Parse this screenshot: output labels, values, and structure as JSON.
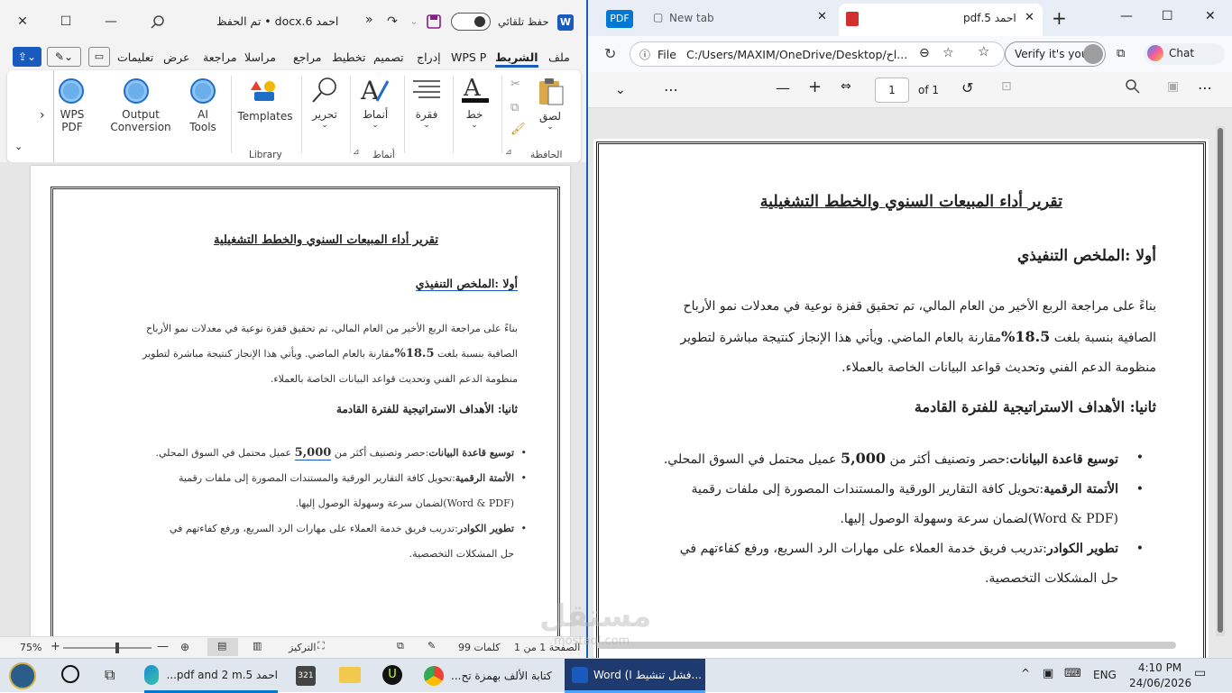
{
  "word": {
    "titlebar": {
      "autosave_label": "حفظ تلقائي",
      "doc_title": "احمد 6.docx • تم الحفظ",
      "expand": "»"
    },
    "tabs": [
      "ملف",
      "الشريط",
      "WPS P",
      "إدراج",
      "تصميم",
      "تخطيط",
      "مراجع",
      "مراسلا",
      "مراجعة",
      "عرض",
      "تعليمات"
    ],
    "ribbon": {
      "buttons": {
        "paste": "لصق",
        "font": "خط",
        "paragraph": "فقرة",
        "styles": "أنماط",
        "edit": "تحرير",
        "templates": "Templates",
        "ai_tools": "AI Tools",
        "output_conversion": "Output Conversion",
        "wps_pdf": "WPS PDF"
      },
      "groups": {
        "clipboard": "الحافظة",
        "styles": "أنماط",
        "library": "Library"
      },
      "more": "›"
    },
    "status": {
      "page": "الصفحة 1 من 1",
      "words": "99 كلمات",
      "focus": "التركيز",
      "zoom": "75%"
    }
  },
  "document": {
    "title": "تقرير أداء المبيعات السنوي والخطط التشغيلية",
    "h1": "أولا :الملخص التنفيذي",
    "p1_a": "بناءً على مراجعة الربع الأخير من العام المالي، تم تحقيق قفزة نوعية في معدلات نمو الأرباح",
    "p1_b_pre": "الصافية بنسبة بلغت ",
    "p1_b_bold": "18.5%",
    "p1_b_post": "مقارنة بالعام الماضي. ويأتي هذا الإنجاز كنتيجة مباشرة لتطوير",
    "p1_c": "منظومة الدعم الفني وتحديث قواعد البيانات الخاصة بالعملاء.",
    "h2": "ثانيا: الأهداف الاستراتيجية للفترة القادمة",
    "b1_bold": "توسيع قاعدة البيانات",
    "b1_text": ":حصر وتصنيف أكثر من ",
    "b1_num": "5,000",
    "b1_tail": " عميل محتمل في السوق المحلي.",
    "b2_bold": "الأتمتة الرقمية",
    "b2_text": ":تحويل كافة التقارير الورقية والمستندات المصورة إلى ملفات رقمية",
    "b2_cont": "(Word & PDF)لضمان سرعة وسهولة الوصول إليها.",
    "b3_bold": "تطوير الكوادر",
    "b3_text": ":تدريب فريق خدمة العملاء على مهارات الرد السريع، ورفع كفاءتهم في",
    "b3_cont": "حل المشكلات التخصصية."
  },
  "edge": {
    "tabs": [
      {
        "label": "PDF"
      },
      {
        "label": "New tab"
      },
      {
        "label": "احمد 5.pdf"
      }
    ],
    "address": {
      "scheme": "File",
      "url": "C:/Users/MAXIM/OneDrive/Desktop/اح...",
      "profile": "Verify it's you",
      "chat": "Chat"
    },
    "pdf": {
      "page_current": "1",
      "page_total": "of 1"
    }
  },
  "taskbar": {
    "items": [
      {
        "label": "احمد 5.pdf and 2 m..."
      },
      {
        "label": "كتابة الألف بهمزة تح..."
      },
      {
        "label": "Word (فشل تنشيط ا..."
      }
    ],
    "lang": "ENG",
    "time": "4:10 PM",
    "date": "24/06/2026"
  },
  "watermark": {
    "text1": "مستقل",
    "text2": "mostaql.com"
  },
  "colors": {
    "word_blue": "#185abd",
    "edge_blue": "#0078d4",
    "taskbar_bg": "#dfe6ee"
  }
}
